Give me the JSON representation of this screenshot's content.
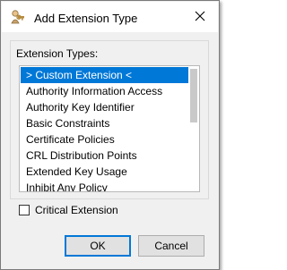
{
  "window": {
    "title": "Add Extension Type",
    "app_icon": "keystore-explorer-icon",
    "close_icon": "close-icon"
  },
  "extension_types": {
    "label": "Extension Types:",
    "items": [
      "> Custom Extension <",
      "Authority Information Access",
      "Authority Key Identifier",
      "Basic Constraints",
      "Certificate Policies",
      "CRL Distribution Points",
      "Extended Key Usage",
      "Inhibit Any Policy"
    ],
    "selected_index": 0
  },
  "critical": {
    "label": "Critical Extension",
    "checked": false
  },
  "buttons": {
    "ok_label": "OK",
    "cancel_label": "Cancel"
  },
  "colors": {
    "selection": "#0078d7",
    "default_button_border": "#0078d7"
  }
}
